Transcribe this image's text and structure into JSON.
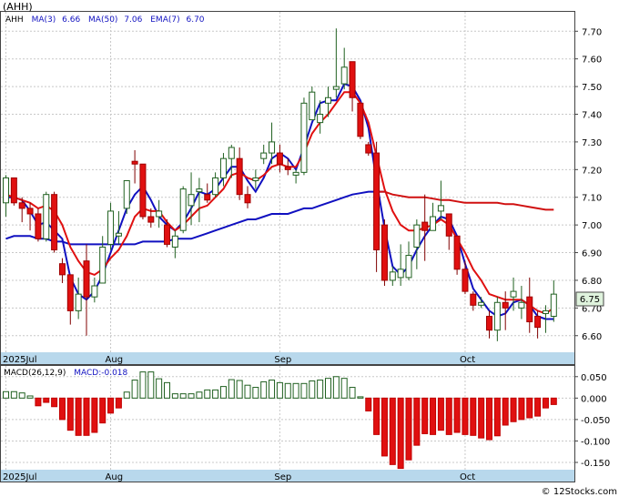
{
  "chart_data": [
    {
      "type": "candlestick",
      "title": "(AHH)",
      "legend": [
        {
          "label": "AHH",
          "color": "#000000"
        },
        {
          "label": "MA(3)",
          "value": "6.66",
          "color": "#1010c0"
        },
        {
          "label": "MA(50)",
          "value": "7.06",
          "color": "#1010c0"
        },
        {
          "label": "EMA(7)",
          "value": "6.70",
          "color": "#1010c0"
        }
      ],
      "ylim": [
        6.54,
        7.77
      ],
      "y_ticks": [
        "7.70",
        "7.60",
        "7.50",
        "7.40",
        "7.30",
        "7.20",
        "7.10",
        "7.00",
        "6.90",
        "6.80",
        "6.70",
        "6.60"
      ],
      "x_labels": [
        {
          "label": "2025Jul",
          "index": 0
        },
        {
          "label": "Aug",
          "index": 13
        },
        {
          "label": "Sep",
          "index": 34
        },
        {
          "label": "Oct",
          "index": 57
        }
      ],
      "last_price": "6.75",
      "candles": [
        [
          7.08,
          7.18,
          7.03,
          7.17
        ],
        [
          7.17,
          7.17,
          7.07,
          7.08
        ],
        [
          7.08,
          7.1,
          7.01,
          7.06
        ],
        [
          7.06,
          7.08,
          6.98,
          7.04
        ],
        [
          7.04,
          7.06,
          6.94,
          6.95
        ],
        [
          6.95,
          7.12,
          6.94,
          7.11
        ],
        [
          7.11,
          7.12,
          6.9,
          6.91
        ],
        [
          6.86,
          6.88,
          6.79,
          6.82
        ],
        [
          6.82,
          6.82,
          6.64,
          6.69
        ],
        [
          6.69,
          6.81,
          6.66,
          6.75
        ],
        [
          6.87,
          6.93,
          6.6,
          6.74
        ],
        [
          6.74,
          6.81,
          6.72,
          6.78
        ],
        [
          6.79,
          6.96,
          6.79,
          6.92
        ],
        [
          6.93,
          7.08,
          6.91,
          7.05
        ],
        [
          6.96,
          7.05,
          6.93,
          6.97
        ],
        [
          7.06,
          7.16,
          7.04,
          7.16
        ],
        [
          7.23,
          7.27,
          7.15,
          7.22
        ],
        [
          7.22,
          7.22,
          7.02,
          7.03
        ],
        [
          7.03,
          7.06,
          6.99,
          7.01
        ],
        [
          7.03,
          7.09,
          6.99,
          7.05
        ],
        [
          7.0,
          7.02,
          6.92,
          6.93
        ],
        [
          6.92,
          6.98,
          6.88,
          6.96
        ],
        [
          6.98,
          7.14,
          6.97,
          7.13
        ],
        [
          7.07,
          7.19,
          7.0,
          7.11
        ],
        [
          7.12,
          7.17,
          7.01,
          7.13
        ],
        [
          7.11,
          7.15,
          7.08,
          7.09
        ],
        [
          7.11,
          7.19,
          7.1,
          7.17
        ],
        [
          7.17,
          7.26,
          7.14,
          7.24
        ],
        [
          7.24,
          7.29,
          7.17,
          7.28
        ],
        [
          7.24,
          7.28,
          7.09,
          7.11
        ],
        [
          7.11,
          7.14,
          7.06,
          7.08
        ],
        [
          7.16,
          7.2,
          7.13,
          7.17
        ],
        [
          7.24,
          7.29,
          7.22,
          7.26
        ],
        [
          7.26,
          7.37,
          7.22,
          7.3
        ],
        [
          7.26,
          7.29,
          7.19,
          7.22
        ],
        [
          7.21,
          7.24,
          7.18,
          7.2
        ],
        [
          7.18,
          7.2,
          7.15,
          7.19
        ],
        [
          7.19,
          7.46,
          7.18,
          7.44
        ],
        [
          7.38,
          7.5,
          7.38,
          7.48
        ],
        [
          7.37,
          7.45,
          7.33,
          7.4
        ],
        [
          7.44,
          7.5,
          7.39,
          7.46
        ],
        [
          7.49,
          7.71,
          7.46,
          7.5
        ],
        [
          7.51,
          7.64,
          7.49,
          7.57
        ],
        [
          7.59,
          7.59,
          7.41,
          7.46
        ],
        [
          7.44,
          7.44,
          7.31,
          7.32
        ],
        [
          7.29,
          7.3,
          7.25,
          7.26
        ],
        [
          7.26,
          7.3,
          6.83,
          6.91
        ],
        [
          7.0,
          7.02,
          6.78,
          6.8
        ],
        [
          6.8,
          6.85,
          6.78,
          6.83
        ],
        [
          6.81,
          6.93,
          6.78,
          6.84
        ],
        [
          6.81,
          6.94,
          6.8,
          6.89
        ],
        [
          6.92,
          7.02,
          6.84,
          7.0
        ],
        [
          7.01,
          7.11,
          6.87,
          6.98
        ],
        [
          6.98,
          7.08,
          6.98,
          7.03
        ],
        [
          7.05,
          7.16,
          7.02,
          7.07
        ],
        [
          7.04,
          7.04,
          6.91,
          6.96
        ],
        [
          6.96,
          6.96,
          6.82,
          6.84
        ],
        [
          6.84,
          6.87,
          6.75,
          6.76
        ],
        [
          6.75,
          6.76,
          6.69,
          6.71
        ],
        [
          6.71,
          6.74,
          6.7,
          6.72
        ],
        [
          6.67,
          6.69,
          6.59,
          6.62
        ],
        [
          6.62,
          6.74,
          6.58,
          6.72
        ],
        [
          6.72,
          6.76,
          6.62,
          6.7
        ],
        [
          6.74,
          6.81,
          6.69,
          6.76
        ],
        [
          6.7,
          6.78,
          6.66,
          6.72
        ],
        [
          6.74,
          6.81,
          6.61,
          6.65
        ],
        [
          6.67,
          6.69,
          6.59,
          6.63
        ],
        [
          6.68,
          6.71,
          6.61,
          6.69
        ],
        [
          6.67,
          6.8,
          6.65,
          6.75
        ]
      ],
      "series": [
        {
          "name": "MA(3)",
          "color": "#1010c0",
          "values": [
            7.1,
            7.1,
            7.09,
            7.05,
            7.0,
            7.01,
            6.98,
            6.95,
            6.81,
            6.75,
            6.73,
            6.76,
            6.82,
            6.9,
            6.98,
            7.06,
            7.11,
            7.14,
            7.09,
            7.03,
            7.0,
            6.98,
            7.01,
            7.06,
            7.12,
            7.11,
            7.13,
            7.17,
            7.21,
            7.21,
            7.16,
            7.12,
            7.17,
            7.24,
            7.26,
            7.24,
            7.2,
            7.28,
            7.37,
            7.44,
            7.45,
            7.45,
            7.51,
            7.5,
            7.45,
            7.35,
            7.16,
            6.99,
            6.85,
            6.82,
            6.85,
            6.91,
            6.96,
            7.0,
            7.03,
            7.02,
            6.96,
            6.86,
            6.77,
            6.73,
            6.69,
            6.67,
            6.68,
            6.72,
            6.73,
            6.71,
            6.67,
            6.66,
            6.66
          ]
        },
        {
          "name": "MA(50)",
          "color": "#1010c0",
          "values": [
            6.95,
            6.96,
            6.96,
            6.96,
            6.95,
            6.95,
            6.94,
            6.94,
            6.93,
            6.93,
            6.93,
            6.93,
            6.93,
            6.93,
            6.93,
            6.93,
            6.93,
            6.94,
            6.94,
            6.94,
            6.94,
            6.95,
            6.95,
            6.95,
            6.96,
            6.97,
            6.98,
            6.99,
            7.0,
            7.01,
            7.02,
            7.02,
            7.03,
            7.04,
            7.04,
            7.04,
            7.05,
            7.06,
            7.06,
            7.07,
            7.08,
            7.09,
            7.1,
            7.11,
            7.115,
            7.12,
            7.12,
            7.12,
            null,
            null,
            null,
            null,
            null,
            null,
            null,
            null,
            null,
            null,
            null,
            null,
            null,
            null,
            null,
            null,
            null,
            null,
            null,
            null,
            null
          ]
        },
        {
          "name": "EMA(7)",
          "color": "#e01010",
          "values": [
            7.11,
            7.1,
            7.09,
            7.08,
            7.06,
            7.07,
            7.05,
            7.0,
            6.92,
            6.87,
            6.83,
            6.82,
            6.84,
            6.88,
            6.91,
            6.96,
            7.03,
            7.06,
            7.05,
            7.05,
            7.01,
            6.98,
            7.0,
            7.03,
            7.06,
            7.07,
            7.1,
            7.13,
            7.18,
            7.19,
            7.17,
            7.16,
            7.18,
            7.21,
            7.22,
            7.21,
            7.21,
            7.26,
            7.33,
            7.37,
            7.4,
            7.44,
            7.48,
            7.48,
            7.44,
            7.37,
            7.25,
            7.13,
            7.05,
            7.0,
            6.98,
            6.98,
            6.99,
            7.0,
            7.02,
            7.0,
            6.95,
            6.9,
            6.84,
            6.8,
            6.75,
            6.74,
            6.73,
            6.73,
            6.73,
            6.71,
            6.69,
            6.68,
            6.7
          ]
        },
        {
          "name": "MA(50) long",
          "color": "#d01010",
          "values": [
            null,
            null,
            null,
            null,
            null,
            null,
            null,
            null,
            null,
            null,
            null,
            null,
            null,
            null,
            null,
            null,
            null,
            null,
            null,
            null,
            null,
            null,
            null,
            null,
            null,
            null,
            null,
            null,
            null,
            null,
            null,
            null,
            null,
            null,
            null,
            null,
            null,
            null,
            null,
            null,
            null,
            null,
            null,
            null,
            null,
            null,
            7.12,
            7.12,
            7.11,
            7.105,
            7.1,
            7.1,
            7.1,
            7.095,
            7.09,
            7.09,
            7.085,
            7.08,
            7.08,
            7.08,
            7.08,
            7.08,
            7.075,
            7.075,
            7.07,
            7.065,
            7.06,
            7.055,
            7.055
          ]
        }
      ]
    },
    {
      "type": "histogram",
      "title": "MACD(26,12,9)",
      "legend": [
        {
          "label": "MACD(26,12,9)",
          "color": "#000000"
        },
        {
          "label": "MACD:-0.018",
          "color": "#1010c0"
        }
      ],
      "ylim": [
        -0.167,
        0.075
      ],
      "y_ticks": [
        "0.050",
        "0.000",
        "-0.050",
        "-0.100",
        "-0.150"
      ],
      "x_labels": [
        {
          "label": "2025Jul",
          "index": 0
        },
        {
          "label": "Aug",
          "index": 13
        },
        {
          "label": "Sep",
          "index": 34
        },
        {
          "label": "Oct",
          "index": 57
        }
      ],
      "values": [
        0.015,
        0.015,
        0.012,
        0.005,
        -0.018,
        -0.01,
        -0.02,
        -0.05,
        -0.075,
        -0.087,
        -0.087,
        -0.08,
        -0.058,
        -0.035,
        -0.023,
        0.014,
        0.042,
        0.061,
        0.061,
        0.045,
        0.036,
        0.01,
        0.01,
        0.01,
        0.014,
        0.019,
        0.019,
        0.027,
        0.043,
        0.041,
        0.03,
        0.025,
        0.038,
        0.042,
        0.036,
        0.034,
        0.034,
        0.034,
        0.04,
        0.042,
        0.046,
        0.05,
        0.046,
        0.025,
        0.003,
        -0.03,
        -0.085,
        -0.135,
        -0.155,
        -0.164,
        -0.144,
        -0.11,
        -0.083,
        -0.085,
        -0.075,
        -0.085,
        -0.08,
        -0.085,
        -0.087,
        -0.093,
        -0.097,
        -0.088,
        -0.063,
        -0.055,
        -0.05,
        -0.046,
        -0.042,
        -0.023,
        -0.015
      ]
    }
  ],
  "watermark": "© 12Stocks.com"
}
